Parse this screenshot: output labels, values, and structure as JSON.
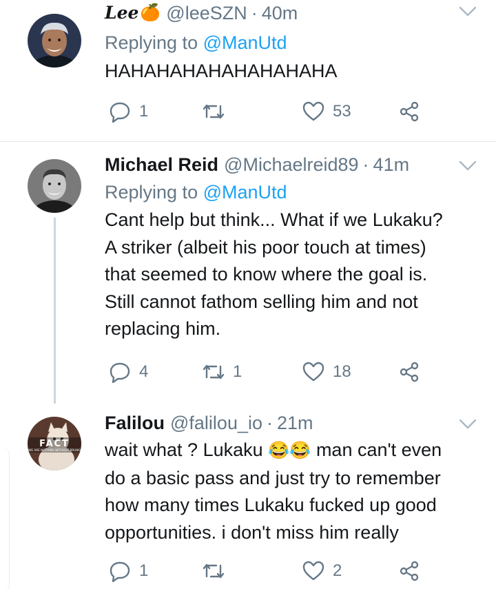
{
  "tweets": [
    {
      "display_name": "Lee",
      "emoji": "🍊",
      "handle": "@leeSZN",
      "separator": "·",
      "time": "40m",
      "reply_prefix": "Replying to",
      "reply_to": "@ManUtd",
      "text_lines": [
        "HAHAHAHAHAHAHAHAHA"
      ],
      "replies": "1",
      "retweets": "",
      "likes": "53"
    },
    {
      "display_name": "Michael Reid",
      "handle": "@Michaelreid89",
      "separator": "·",
      "time": "41m",
      "reply_prefix": "Replying to",
      "reply_to": "@ManUtd",
      "text_lines": [
        "Cant help but think... What if we Lukaku?",
        "A striker (albeit his poor touch at times)",
        "that seemed to know where the goal is.",
        "Still cannot fathom selling him and not",
        "replacing him."
      ],
      "replies": "4",
      "retweets": "1",
      "likes": "18"
    },
    {
      "display_name": "Falilou",
      "handle": "@falilou_io",
      "separator": "·",
      "time": "21m",
      "avatar_text": "FACT",
      "avatar_subtext": "WE ARE NOTHING WITHOUT BRUNO",
      "text_line1_before": "wait what ? Lukaku",
      "text_emoji": "😂😂",
      "text_line1_after": "man can't even",
      "text_lines": [
        "do a basic pass and just try to remember",
        "how many times Lukaku fucked up good",
        "opportunities. i don't miss him really"
      ],
      "replies": "1",
      "retweets": "",
      "likes": "2"
    }
  ],
  "colors": {
    "link": "#1da1f2",
    "muted": "#657786",
    "text": "#14171a",
    "divider": "#e1e8ed",
    "thread_line": "#ccd6dd"
  },
  "icons": [
    "reply-icon",
    "retweet-icon",
    "like-icon",
    "share-icon",
    "chevron-down-icon"
  ]
}
